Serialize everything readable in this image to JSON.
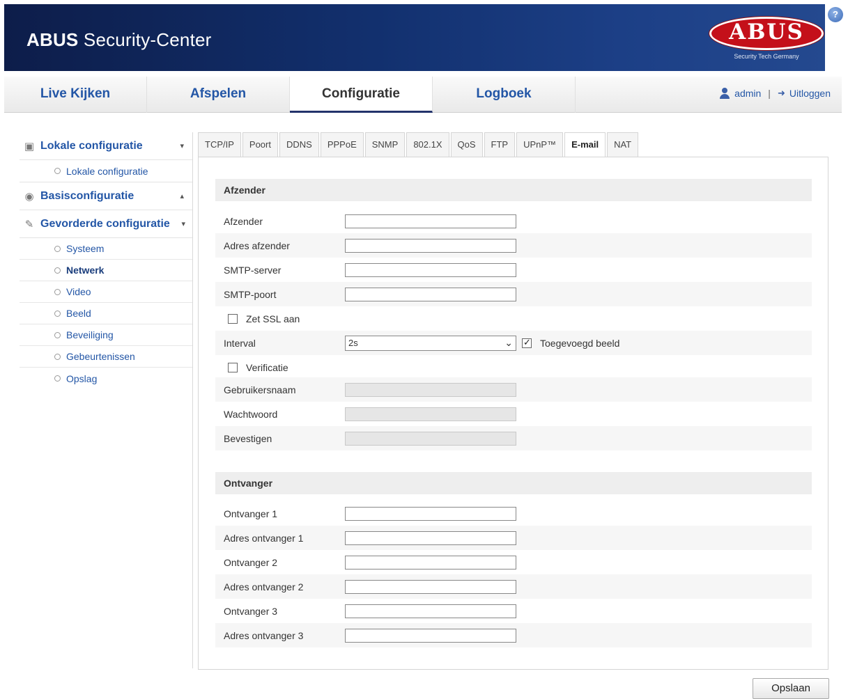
{
  "header": {
    "title_bold": "ABUS",
    "title_rest": " Security-Center",
    "logo_text": "ABUS",
    "logo_sub": "Security Tech Germany",
    "help": "?"
  },
  "nav": {
    "tabs": [
      {
        "label": "Live Kijken"
      },
      {
        "label": "Afspelen"
      },
      {
        "label": "Configuratie"
      },
      {
        "label": "Logboek"
      }
    ],
    "user": "admin",
    "separator": "|",
    "logout": "Uitloggen"
  },
  "sidebar": {
    "local": {
      "label": "Lokale configuratie",
      "items": [
        "Lokale configuratie"
      ]
    },
    "basic": {
      "label": "Basisconfiguratie"
    },
    "advanced": {
      "label": "Gevorderde configuratie",
      "items": [
        "Systeem",
        "Netwerk",
        "Video",
        "Beeld",
        "Beveiliging",
        "Gebeurtenissen",
        "Opslag"
      ]
    }
  },
  "subtabs": [
    "TCP/IP",
    "Poort",
    "DDNS",
    "PPPoE",
    "SNMP",
    "802.1X",
    "QoS",
    "FTP",
    "UPnP™",
    "E-mail",
    "NAT"
  ],
  "sender": {
    "title": "Afzender",
    "fields": {
      "name": {
        "label": "Afzender",
        "value": ""
      },
      "address": {
        "label": "Adres afzender",
        "value": ""
      },
      "smtp_server": {
        "label": "SMTP-server",
        "value": ""
      },
      "smtp_port": {
        "label": "SMTP-poort",
        "value": ""
      }
    },
    "ssl_label": "Zet SSL aan",
    "interval": {
      "label": "Interval",
      "value": "2s"
    },
    "attached_label": "Toegevoegd beeld",
    "verify_label": "Verificatie",
    "username": {
      "label": "Gebruikersnaam",
      "value": ""
    },
    "password": {
      "label": "Wachtwoord",
      "value": ""
    },
    "confirm": {
      "label": "Bevestigen",
      "value": ""
    }
  },
  "receiver": {
    "title": "Ontvanger",
    "fields": {
      "r1": {
        "label": "Ontvanger 1",
        "value": ""
      },
      "a1": {
        "label": "Adres ontvanger 1",
        "value": ""
      },
      "r2": {
        "label": "Ontvanger 2",
        "value": ""
      },
      "a2": {
        "label": "Adres ontvanger 2",
        "value": ""
      },
      "r3": {
        "label": "Ontvanger 3",
        "value": ""
      },
      "a3": {
        "label": "Adres ontvanger 3",
        "value": ""
      }
    }
  },
  "save_label": "Opslaan"
}
